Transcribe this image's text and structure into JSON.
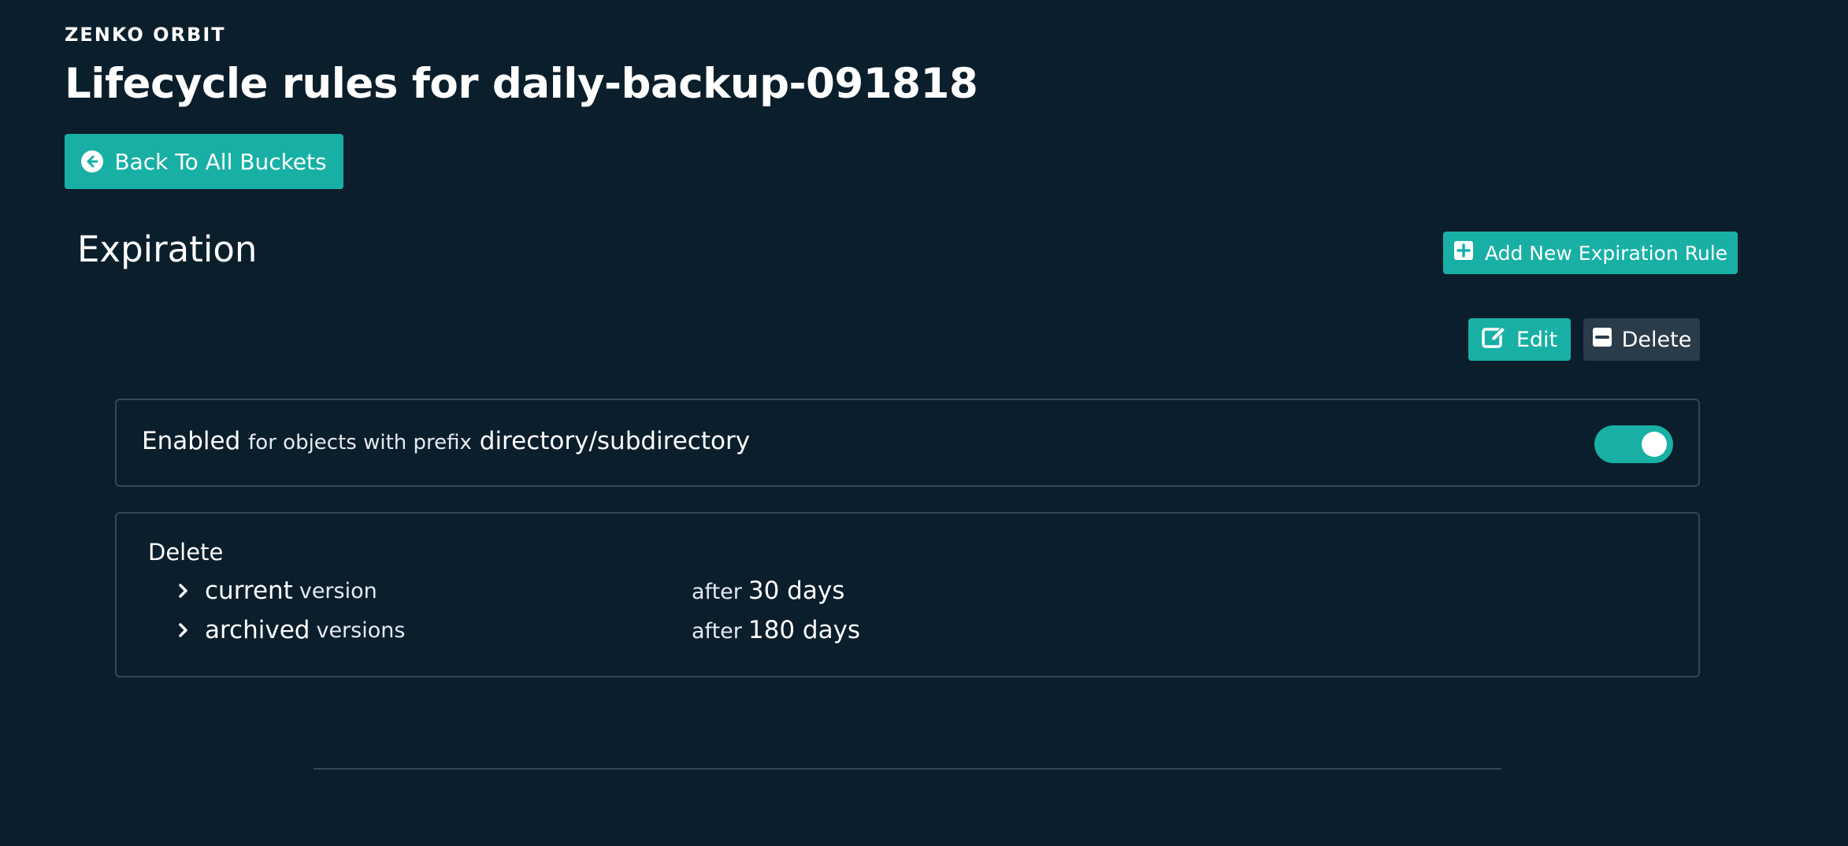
{
  "header": {
    "brand": "ZENKO ORBIT",
    "title": "Lifecycle rules for daily-backup-091818",
    "back_button_label": "Back To All Buckets"
  },
  "expiration": {
    "section_title": "Expiration",
    "add_rule_label": "Add New Expiration Rule",
    "edit_label": "Edit",
    "delete_label": "Delete",
    "rule": {
      "status": "Enabled",
      "prefix_text": "for objects with prefix",
      "prefix": "directory/subdirectory",
      "enabled": true
    },
    "actions": {
      "title": "Delete",
      "rows": [
        {
          "name": "current",
          "qualifier": "version",
          "after_label": "after",
          "after_value": "30 days"
        },
        {
          "name": "archived",
          "qualifier": "versions",
          "after_label": "after",
          "after_value": "180 days"
        }
      ]
    }
  },
  "colors": {
    "background": "#0b1e2c",
    "accent": "#18b0a5",
    "secondary_button": "#2a3b49",
    "border": "#33485a"
  },
  "icons": {
    "back": "arrow-circle-left-icon",
    "add": "plus-square-icon",
    "edit": "edit-icon",
    "delete": "minus-square-icon",
    "expand": "chevron-right-icon"
  }
}
